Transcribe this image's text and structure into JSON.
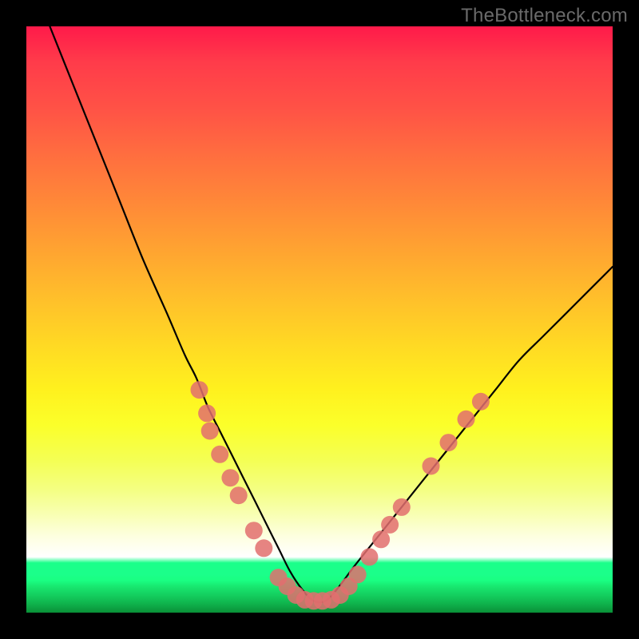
{
  "watermark": "TheBottleneck.com",
  "colors": {
    "frame": "#000000",
    "curve": "#000000",
    "markers": "#e26f6f",
    "gradient_top": "#ff1a4a",
    "gradient_mid": "#fff11e",
    "gradient_white": "#ffffff",
    "gradient_green": "#1bff8a"
  },
  "chart_data": {
    "type": "line",
    "title": "",
    "xlabel": "",
    "ylabel": "",
    "xlim": [
      0,
      100
    ],
    "ylim": [
      0,
      100
    ],
    "series": [
      {
        "name": "bottleneck-curve",
        "x": [
          4,
          8,
          12,
          16,
          20,
          24,
          27,
          29,
          31,
          33,
          35,
          37,
          39,
          41,
          43,
          45,
          47,
          49,
          51,
          53,
          56,
          60,
          64,
          68,
          72,
          76,
          80,
          84,
          88,
          92,
          96,
          100
        ],
        "y": [
          100,
          90,
          80,
          70,
          60,
          51,
          44,
          40,
          35,
          31,
          27,
          23,
          19,
          15,
          11,
          7,
          4,
          2,
          2,
          4,
          8,
          13,
          18,
          23,
          28,
          33,
          38,
          43,
          47,
          51,
          55,
          59
        ]
      }
    ],
    "markers": [
      {
        "x": 29.5,
        "y": 38
      },
      {
        "x": 30.8,
        "y": 34
      },
      {
        "x": 31.3,
        "y": 31
      },
      {
        "x": 33.0,
        "y": 27
      },
      {
        "x": 34.8,
        "y": 23
      },
      {
        "x": 36.2,
        "y": 20
      },
      {
        "x": 38.8,
        "y": 14
      },
      {
        "x": 40.5,
        "y": 11
      },
      {
        "x": 43.0,
        "y": 6
      },
      {
        "x": 44.5,
        "y": 4.5
      },
      {
        "x": 46.0,
        "y": 3
      },
      {
        "x": 47.5,
        "y": 2.2
      },
      {
        "x": 49.0,
        "y": 2
      },
      {
        "x": 50.5,
        "y": 2
      },
      {
        "x": 52.0,
        "y": 2.2
      },
      {
        "x": 53.5,
        "y": 3
      },
      {
        "x": 55.0,
        "y": 4.5
      },
      {
        "x": 56.5,
        "y": 6.5
      },
      {
        "x": 58.5,
        "y": 9.5
      },
      {
        "x": 60.5,
        "y": 12.5
      },
      {
        "x": 62.0,
        "y": 15
      },
      {
        "x": 64.0,
        "y": 18
      },
      {
        "x": 69.0,
        "y": 25
      },
      {
        "x": 72.0,
        "y": 29
      },
      {
        "x": 75.0,
        "y": 33
      },
      {
        "x": 77.5,
        "y": 36
      }
    ],
    "marker_radius_px": 11,
    "background_zones": [
      {
        "name": "red",
        "from_pct": 0,
        "to_pct": 60
      },
      {
        "name": "yellow",
        "from_pct": 60,
        "to_pct": 90
      },
      {
        "name": "white",
        "from_pct": 90,
        "to_pct": 92
      },
      {
        "name": "green",
        "from_pct": 92,
        "to_pct": 100
      }
    ]
  }
}
